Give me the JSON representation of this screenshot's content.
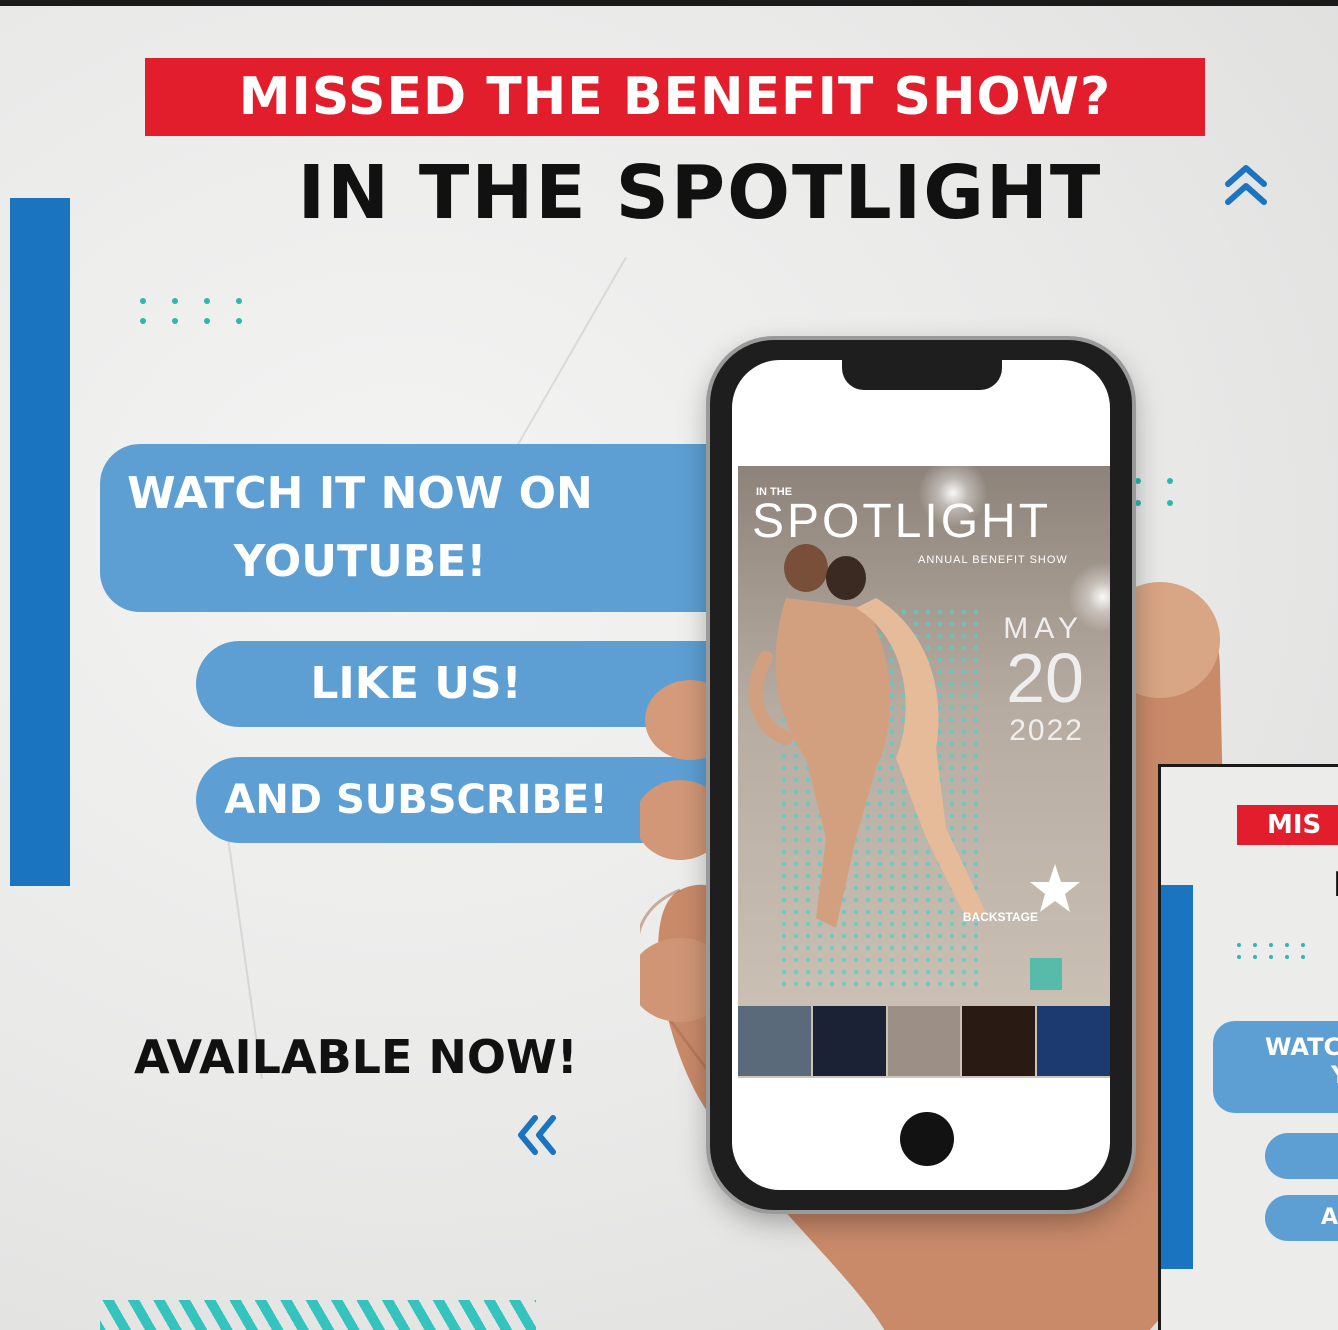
{
  "banner_text": "MISSED THE BENEFIT SHOW?",
  "headline": "IN THE SPOTLIGHT",
  "pills": {
    "watch_line1": "WATCH IT NOW ON",
    "watch_line2": "YOUTUBE!",
    "like": "LIKE US!",
    "subscribe": "AND SUBSCRIBE!"
  },
  "available": "AVAILABLE NOW!",
  "icons": {
    "chevron_left": "double-chevron-left-icon",
    "chevron_up": "double-chevron-up-icon"
  },
  "phone_poster": {
    "small_label": "IN THE",
    "title": "SPOTLIGHT",
    "subtitle": "ANNUAL BENEFIT SHOW",
    "month": "MAY",
    "day": "20",
    "year": "2022",
    "logo": "BACKSTAGE"
  },
  "inset": {
    "banner": "MIS",
    "headline_fragment": "I",
    "watch_fragment_1": "WATC",
    "watch_fragment_2": "Y",
    "subscribe_fragment": "A"
  },
  "colors": {
    "accent_red": "#e21e2d",
    "accent_blue": "#1b74c0",
    "pill_blue": "#5d9fd3",
    "teal": "#2cb8b0"
  }
}
